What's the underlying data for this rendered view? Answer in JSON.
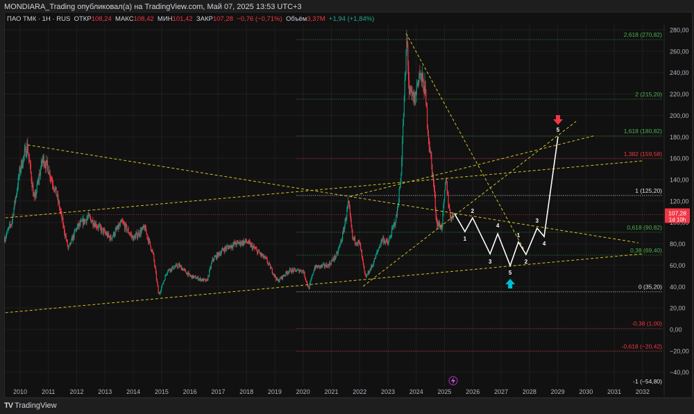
{
  "header": {
    "title": "MONDIARA_Trading опубликовал(а) на TradingView.com, Май 07, 2025 13:53 UTC+3"
  },
  "legend": {
    "symbol": "ПАО ТМК · 1Н · RUS",
    "open_label": "ОТКР",
    "open": "108,24",
    "high_label": "МАКС",
    "high": "108,42",
    "low_label": "МИН",
    "low": "101,42",
    "close_label": "ЗАКР",
    "close": "107,28",
    "change": "−0,76 (−0,71%)",
    "volume_label": "Объём",
    "volume": "3,37M",
    "vol_change": "+1,94 (+1,84%)"
  },
  "footer": {
    "brand": "TradingView"
  },
  "colors": {
    "up": "#089981",
    "down": "#f23645",
    "trend": "#d4c22a",
    "wave": "#ffffff",
    "fib_green": "#4caf50",
    "fib_red": "#f23645",
    "fib_gray": "#b2b5be"
  },
  "price_tag": {
    "price": "107,28",
    "countdown": "1d 10h"
  },
  "chart_data": {
    "type": "candlestick",
    "y_ticks": [
      "280,00",
      "260,00",
      "240,00",
      "220,00",
      "200,00",
      "180,00",
      "160,00",
      "140,00",
      "120,00",
      "100,00",
      "80,00",
      "60,00",
      "40,00",
      "20,00",
      "0,00",
      "−20,00",
      "−40,00"
    ],
    "y_tick_values": [
      280,
      260,
      240,
      220,
      200,
      180,
      160,
      140,
      120,
      100,
      80,
      60,
      40,
      20,
      0,
      -20,
      -40
    ],
    "x_ticks": [
      "2010",
      "2011",
      "2012",
      "2013",
      "2014",
      "2015",
      "2016",
      "2017",
      "2018",
      "2019",
      "2020",
      "2021",
      "2022",
      "2023",
      "2024",
      "2025",
      "2026",
      "2027",
      "2028",
      "2029",
      "2030",
      "2031",
      "2032"
    ],
    "ylim": [
      -60,
      290
    ],
    "xlim": [
      2009.45,
      2032.7
    ],
    "last_price": 107.28,
    "price_anchors": [
      [
        2009.45,
        85
      ],
      [
        2009.7,
        100
      ],
      [
        2010.0,
        150
      ],
      [
        2010.25,
        172
      ],
      [
        2010.5,
        120
      ],
      [
        2010.8,
        160
      ],
      [
        2011.0,
        150
      ],
      [
        2011.3,
        125
      ],
      [
        2011.5,
        100
      ],
      [
        2011.7,
        75
      ],
      [
        2012.0,
        95
      ],
      [
        2012.4,
        105
      ],
      [
        2012.8,
        95
      ],
      [
        2013.2,
        85
      ],
      [
        2013.6,
        100
      ],
      [
        2014.0,
        85
      ],
      [
        2014.4,
        95
      ],
      [
        2014.7,
        70
      ],
      [
        2014.9,
        32
      ],
      [
        2015.2,
        55
      ],
      [
        2015.6,
        60
      ],
      [
        2016.0,
        50
      ],
      [
        2016.6,
        45
      ],
      [
        2016.8,
        65
      ],
      [
        2017.2,
        75
      ],
      [
        2017.6,
        80
      ],
      [
        2018.0,
        82
      ],
      [
        2018.3,
        75
      ],
      [
        2018.7,
        65
      ],
      [
        2019.1,
        45
      ],
      [
        2019.5,
        55
      ],
      [
        2020.0,
        55
      ],
      [
        2020.2,
        38
      ],
      [
        2020.4,
        58
      ],
      [
        2020.9,
        60
      ],
      [
        2021.2,
        70
      ],
      [
        2021.4,
        88
      ],
      [
        2021.6,
        118
      ],
      [
        2021.75,
        85
      ],
      [
        2022.0,
        80
      ],
      [
        2022.2,
        48
      ],
      [
        2022.45,
        60
      ],
      [
        2022.8,
        85
      ],
      [
        2023.0,
        80
      ],
      [
        2023.3,
        105
      ],
      [
        2023.45,
        140
      ],
      [
        2023.6,
        230
      ],
      [
        2023.67,
        275
      ],
      [
        2023.75,
        220
      ],
      [
        2023.95,
        215
      ],
      [
        2024.1,
        240
      ],
      [
        2024.3,
        225
      ],
      [
        2024.45,
        175
      ],
      [
        2024.6,
        140
      ],
      [
        2024.72,
        100
      ],
      [
        2024.9,
        95
      ],
      [
        2025.05,
        140
      ],
      [
        2025.2,
        105
      ],
      [
        2025.35,
        107.28
      ]
    ],
    "fib_levels": [
      {
        "label": "2,618 (270,82)",
        "price": 270.82,
        "color": "green"
      },
      {
        "label": "2 (215,20)",
        "price": 215.2,
        "color": "green"
      },
      {
        "label": "1,618 (180,82)",
        "price": 180.82,
        "color": "green"
      },
      {
        "label": "1,382 (159,58)",
        "price": 159.58,
        "color": "red"
      },
      {
        "label": "1 (125,20)",
        "price": 125.2,
        "color": "gray"
      },
      {
        "label": "0,618 (90,82)",
        "price": 90.82,
        "color": "green"
      },
      {
        "label": "0,38 (69,40)",
        "price": 69.4,
        "color": "green"
      },
      {
        "label": "0 (35,20)",
        "price": 35.2,
        "color": "gray"
      },
      {
        "label": "-0,38 (1,00)",
        "price": 1.0,
        "color": "red"
      },
      {
        "label": "-0,618 (−20,42)",
        "price": -20.42,
        "color": "red"
      },
      {
        "label": "-1 (−54,80)",
        "price": -54.8,
        "color": "gray"
      }
    ],
    "trend_lines": [
      [
        [
          2010.27,
          172.4
        ],
        [
          2031.85,
          81.0
        ]
      ],
      [
        [
          2009.48,
          15.6
        ],
        [
          2031.98,
          70.6
        ]
      ],
      [
        [
          2009.48,
          104.3
        ],
        [
          2031.98,
          157.5
        ]
      ],
      [
        [
          2021.68,
          124.4
        ],
        [
          2030.26,
          180.8
        ]
      ],
      [
        [
          2023.64,
          276.7
        ],
        [
          2027.81,
          74.5
        ]
      ],
      [
        [
          2022.12,
          40.2
        ],
        [
          2029.65,
          194.4
        ]
      ]
    ],
    "wave_path": [
      [
        2025.35,
        108.2
      ],
      [
        2025.72,
        91.4
      ],
      [
        2025.99,
        104.3
      ],
      [
        2026.61,
        70.6
      ],
      [
        2026.88,
        89.4
      ],
      [
        2027.32,
        59.6
      ],
      [
        2027.61,
        81.7
      ],
      [
        2027.88,
        70.0
      ],
      [
        2028.27,
        94.6
      ],
      [
        2028.52,
        86.8
      ],
      [
        2029.01,
        180.2
      ]
    ],
    "wave_labels": [
      "1",
      "2",
      "3",
      "4",
      "5",
      "1",
      "2",
      "3",
      "4",
      "5"
    ],
    "markers": [
      {
        "type": "arrow-up",
        "at": [
          2027.32,
          59.6
        ],
        "color": "#00bcd4"
      },
      {
        "type": "arrow-down",
        "at": [
          2029.01,
          180.2
        ],
        "color": "#f23645"
      }
    ]
  }
}
